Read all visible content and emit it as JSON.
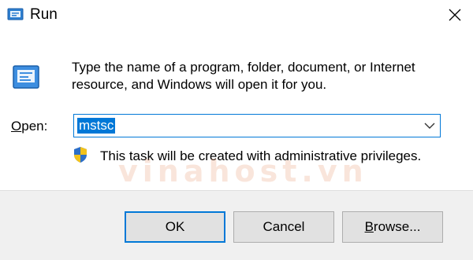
{
  "window": {
    "title": "Run",
    "icon": "run-app-icon",
    "close_icon": "close-icon"
  },
  "body": {
    "description": "Type the name of a program, folder, document, or Internet resource, and Windows will open it for you.",
    "icon": "run-dialog-icon",
    "open_label_accel": "O",
    "open_label_rest": "pen:",
    "open_value": "mstsc",
    "admin_notice": "This task will be created with administrative privileges.",
    "admin_icon": "uac-shield-icon",
    "watermark": "vinahost.vn"
  },
  "buttons": {
    "ok": "OK",
    "cancel": "Cancel",
    "browse_accel": "B",
    "browse_rest": "rowse..."
  },
  "colors": {
    "accent": "#0078d7",
    "footer_bg": "#f0f0f0",
    "button_bg": "#e1e1e1"
  }
}
